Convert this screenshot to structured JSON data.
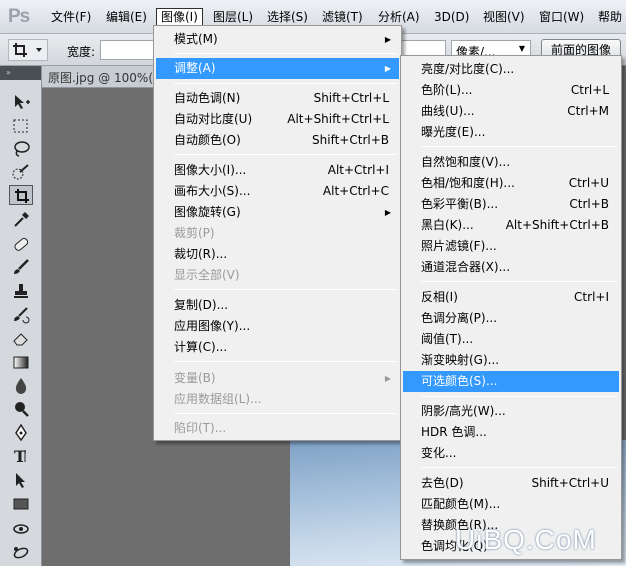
{
  "app": {
    "logo": "Ps"
  },
  "menubar": {
    "items": [
      "文件(F)",
      "编辑(E)",
      "图像(I)",
      "图层(L)",
      "选择(S)",
      "滤镜(T)",
      "分析(A)",
      "3D(D)",
      "视图(V)",
      "窗口(W)",
      "帮助"
    ],
    "active_index": 2
  },
  "options_bar": {
    "width_label": "宽度:",
    "width_value": "",
    "resolution_value": "",
    "unit_select": "像素/...",
    "front_image_button": "前面的图像"
  },
  "tool_panel": {
    "header": "»",
    "tools": [
      "move-tool",
      "marquee-tool",
      "lasso-tool",
      "quick-select-tool",
      "crop-tool",
      "eyedropper-tool",
      "healing-brush-tool",
      "brush-tool",
      "clone-stamp-tool",
      "history-brush-tool",
      "eraser-tool",
      "gradient-tool",
      "blur-tool",
      "dodge-tool",
      "pen-tool",
      "type-tool",
      "path-select-tool",
      "shape-tool",
      "3d-rotate-tool",
      "3d-orbit-tool"
    ],
    "selected_tool": "crop-tool"
  },
  "document": {
    "tab_title": "原图.jpg @ 100%(R"
  },
  "image_menu": {
    "items": [
      {
        "label": "模式(M)",
        "shortcut": "",
        "submenu": true,
        "disabled": false
      },
      {
        "label": "调整(A)",
        "shortcut": "",
        "submenu": true,
        "disabled": false,
        "highlighted": true
      },
      {
        "label": "自动色调(N)",
        "shortcut": "Shift+Ctrl+L",
        "disabled": false
      },
      {
        "label": "自动对比度(U)",
        "shortcut": "Alt+Shift+Ctrl+L",
        "disabled": false
      },
      {
        "label": "自动颜色(O)",
        "shortcut": "Shift+Ctrl+B",
        "disabled": false
      },
      {
        "label": "图像大小(I)...",
        "shortcut": "Alt+Ctrl+I",
        "disabled": false
      },
      {
        "label": "画布大小(S)...",
        "shortcut": "Alt+Ctrl+C",
        "disabled": false
      },
      {
        "label": "图像旋转(G)",
        "shortcut": "",
        "submenu": true,
        "disabled": false
      },
      {
        "label": "裁剪(P)",
        "shortcut": "",
        "disabled": true
      },
      {
        "label": "裁切(R)...",
        "shortcut": "",
        "disabled": false
      },
      {
        "label": "显示全部(V)",
        "shortcut": "",
        "disabled": true
      },
      {
        "label": "复制(D)...",
        "shortcut": "",
        "disabled": false
      },
      {
        "label": "应用图像(Y)...",
        "shortcut": "",
        "disabled": false
      },
      {
        "label": "计算(C)...",
        "shortcut": "",
        "disabled": false
      },
      {
        "label": "变量(B)",
        "shortcut": "",
        "submenu": true,
        "disabled": true
      },
      {
        "label": "应用数据组(L)...",
        "shortcut": "",
        "disabled": true
      },
      {
        "label": "陷印(T)...",
        "shortcut": "",
        "disabled": true
      }
    ]
  },
  "adjust_menu": {
    "items": [
      {
        "label": "亮度/对比度(C)...",
        "shortcut": ""
      },
      {
        "label": "色阶(L)...",
        "shortcut": "Ctrl+L"
      },
      {
        "label": "曲线(U)...",
        "shortcut": "Ctrl+M"
      },
      {
        "label": "曝光度(E)...",
        "shortcut": ""
      },
      {
        "label": "自然饱和度(V)...",
        "shortcut": ""
      },
      {
        "label": "色相/饱和度(H)...",
        "shortcut": "Ctrl+U"
      },
      {
        "label": "色彩平衡(B)...",
        "shortcut": "Ctrl+B"
      },
      {
        "label": "黑白(K)...",
        "shortcut": "Alt+Shift+Ctrl+B"
      },
      {
        "label": "照片滤镜(F)...",
        "shortcut": ""
      },
      {
        "label": "通道混合器(X)...",
        "shortcut": ""
      },
      {
        "label": "反相(I)",
        "shortcut": "Ctrl+I"
      },
      {
        "label": "色调分离(P)...",
        "shortcut": ""
      },
      {
        "label": "阈值(T)...",
        "shortcut": ""
      },
      {
        "label": "渐变映射(G)...",
        "shortcut": ""
      },
      {
        "label": "可选颜色(S)...",
        "shortcut": "",
        "highlighted": true
      },
      {
        "label": "阴影/高光(W)...",
        "shortcut": ""
      },
      {
        "label": "HDR 色调...",
        "shortcut": ""
      },
      {
        "label": "变化...",
        "shortcut": ""
      },
      {
        "label": "去色(D)",
        "shortcut": "Shift+Ctrl+U"
      },
      {
        "label": "匹配颜色(M)...",
        "shortcut": ""
      },
      {
        "label": "替换颜色(R)...",
        "shortcut": ""
      },
      {
        "label": "色调均化(Q)",
        "shortcut": ""
      }
    ]
  },
  "watermark": "UiBQ.CoM"
}
